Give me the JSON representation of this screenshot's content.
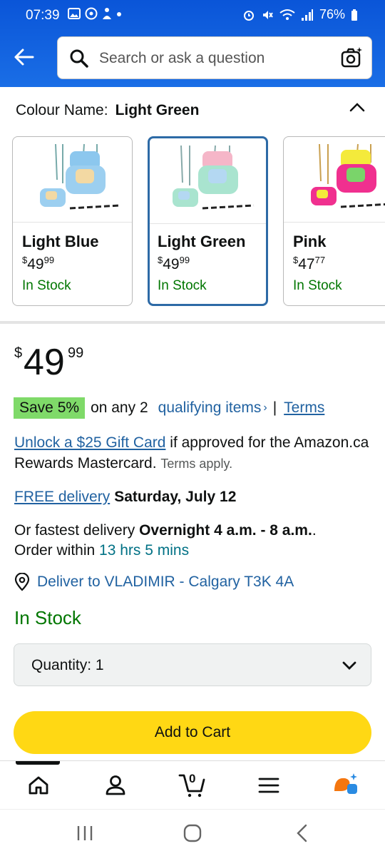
{
  "status_bar": {
    "time": "07:39",
    "battery": "76%"
  },
  "search": {
    "placeholder": "Search or ask a question"
  },
  "colour": {
    "label": "Colour Name:",
    "selected": "Light Green",
    "options": [
      {
        "name": "Light Blue",
        "currency": "$",
        "whole": "49",
        "fraction": "99",
        "stock": "In Stock"
      },
      {
        "name": "Light Green",
        "currency": "$",
        "whole": "49",
        "fraction": "99",
        "stock": "In Stock"
      },
      {
        "name": "Pink",
        "currency": "$",
        "whole": "47",
        "fraction": "77",
        "stock": "In Stock"
      }
    ]
  },
  "price": {
    "currency": "$",
    "whole": "49",
    "fraction": "99"
  },
  "promo": {
    "badge": "Save 5%",
    "text": "on any 2",
    "link": "qualifying items",
    "chevron": "›",
    "separator": "|",
    "terms": "Terms"
  },
  "gift": {
    "link": "Unlock a $25 Gift Card",
    "text": "if approved for the Amazon.ca Rewards Mastercard.",
    "small": "Terms apply."
  },
  "delivery": {
    "link": "FREE delivery",
    "date": "Saturday, July 12",
    "fast_prefix": "Or fastest delivery",
    "fast_time": "Overnight 4 a.m. - 8 a.m.",
    "fast_suffix": ".",
    "order_prefix": "Order within",
    "order_time": "13 hrs 5 mins"
  },
  "location": {
    "text": "Deliver to VLADIMIR - Calgary T3K 4A"
  },
  "availability": "In Stock",
  "quantity": {
    "label": "Quantity: 1"
  },
  "cart_button": "Add to Cart",
  "cart_count": "0",
  "colors": {
    "accent": "#2162a1",
    "cart": "#ffd814",
    "stock": "#007600",
    "header": "#0a55d8",
    "badge": "#7fda69"
  }
}
